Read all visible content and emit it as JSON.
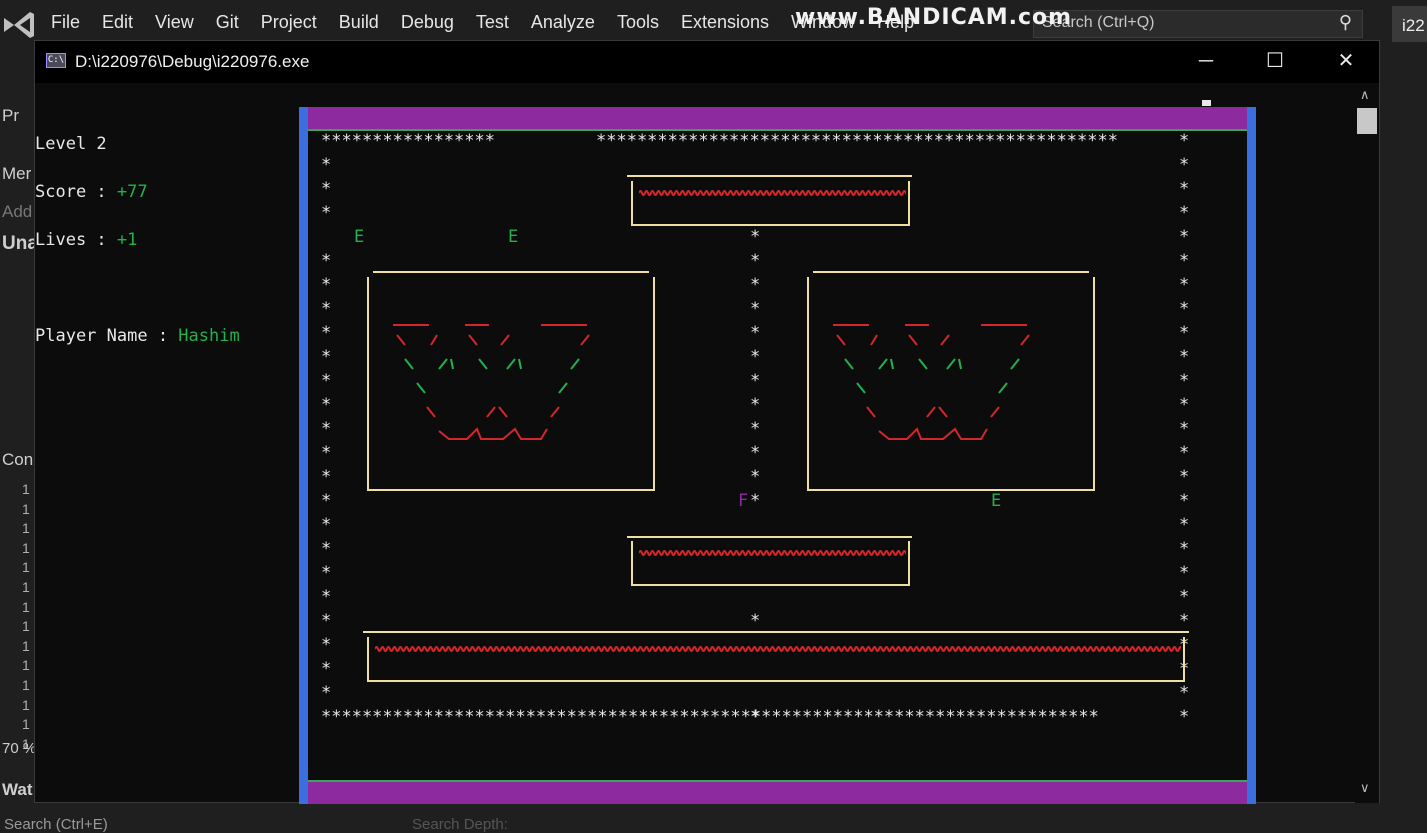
{
  "vs": {
    "menu": [
      "File",
      "Edit",
      "View",
      "Git",
      "Project",
      "Build",
      "Debug",
      "Test",
      "Analyze",
      "Tools",
      "Extensions",
      "Window",
      "Help"
    ],
    "search_placeholder": "Search (Ctrl+Q)",
    "watermark": "www.BANDICAM.com",
    "right_tab": "i22",
    "left_fragments": [
      "Pr",
      "Mer",
      "Add",
      "Una",
      "Con",
      "70 %",
      "Wat"
    ],
    "line_numbers": [
      "1",
      "1",
      "1",
      "1",
      "1",
      "1",
      "1",
      "1",
      "1",
      "1",
      "1",
      "1",
      "1",
      "1"
    ],
    "bottom_search": "Search (Ctrl+E)",
    "bottom_depth": "Search Depth:"
  },
  "console": {
    "title": "D:\\i220976\\Debug\\i220976.exe",
    "buttons": {
      "minimize": "─",
      "maximize": "☐",
      "close": "✕"
    }
  },
  "hud": {
    "level_label": "Level 2",
    "score_label": "Score : ",
    "score_value": "+77",
    "lives_label": "Lives : ",
    "lives_value": "+1",
    "player_label": "Player Name : ",
    "player_value": "Hashim"
  },
  "game": {
    "top_row_left": "*****************",
    "top_row_right": "***************************************************",
    "bottom_row": "****************************************************************************",
    "star": "*",
    "enemy_glyph": "E",
    "food_glyph": "F"
  },
  "colors": {
    "accent_purple": "#8e2aa0",
    "border_blue": "#3b6fe0",
    "enemy_green": "#22b14c",
    "wall_yellow": "#f0e0a0",
    "wave_red": "#d2282c"
  }
}
